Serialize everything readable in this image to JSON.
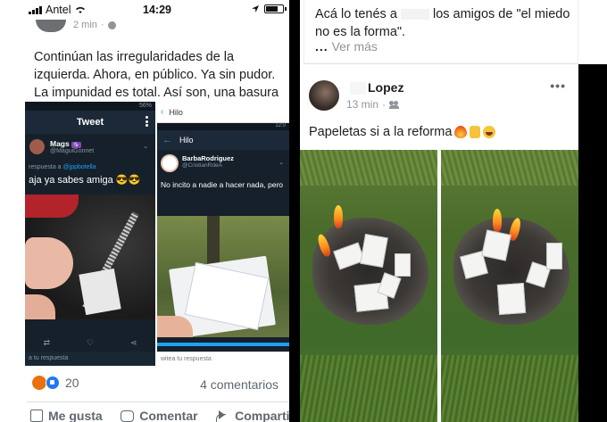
{
  "status_bar": {
    "carrier": "Antel",
    "time": "14:29"
  },
  "left_post": {
    "timestamp": "2 min",
    "text": "Continúan las irregularidades de la izquierda. Ahora, en público. Ya sin pudor. La impunidad es total. Así son, una basura",
    "screenshot_1": {
      "status": "56%",
      "title": "Tweet",
      "user_name": "Mags",
      "user_badge": "♑",
      "user_handle": "@MaguiGonnet",
      "reply_prefix": "respuesta a",
      "reply_to": "@jppbotella",
      "tweet_text": "aja ya sabes amiga 😎😎",
      "compose_placeholder": "a tu respuesta"
    },
    "screenshot_2": {
      "app_title": "Hilo",
      "top_status": "12:0",
      "thread_title": "Hilo",
      "user_name": "BarbaRodriguez",
      "user_handle": "@CristianRdeA",
      "tweet_text": "No incito a nadie a hacer nada, pero",
      "compose_placeholder": "witea tu respuesta"
    },
    "reaction_count": "20",
    "comments": "4 comentarios",
    "actions": {
      "like": "Me gusta",
      "comment": "Comentar",
      "share": "Compartir"
    }
  },
  "right_top_card": {
    "text_before": "Acá lo tenés a",
    "text_after": "los amigos de \"el miedo no es la forma\".",
    "see_more_dots": "...",
    "see_more": "Ver más"
  },
  "right_post": {
    "author": "Lopez",
    "timestamp": "13 min",
    "more": "•••",
    "caption": "Papeletas si a la reforma"
  },
  "colors": {
    "facebook_grey": "#606770",
    "facebook_blue": "#2078f4",
    "twitter_dark": "#15202b",
    "twitter_blue": "#1da1f2"
  }
}
